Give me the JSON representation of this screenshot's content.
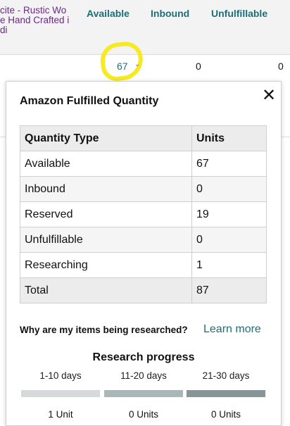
{
  "columns": {
    "available": "Available",
    "inbound": "Inbound",
    "unfulfillable": "Unfulfillable"
  },
  "row": {
    "product_lines": [
      "cite - Rustic Wo",
      "e Hand Crafted i",
      "di"
    ],
    "available": "67",
    "inbound": "0",
    "unfulfillable": "0"
  },
  "popover": {
    "title": "Amazon Fulfilled Quantity",
    "close_icon": "close-icon",
    "table": {
      "headers": [
        "Quantity Type",
        "Units"
      ],
      "rows": [
        {
          "type": "Available",
          "units": "67"
        },
        {
          "type": "Inbound",
          "units": "0"
        },
        {
          "type": "Reserved",
          "units": "19"
        },
        {
          "type": "Unfulfillable",
          "units": "0"
        },
        {
          "type": "Researching",
          "units": "1"
        },
        {
          "type": "Total",
          "units": "87"
        }
      ]
    },
    "research_question": "Why are my items being researched?",
    "learn_more": "Learn more",
    "progress": {
      "title": "Research progress",
      "stages": [
        {
          "label": "1-10 days",
          "count": "1 Unit",
          "color": "#d5d9d9"
        },
        {
          "label": "11-20 days",
          "count": "0 Units",
          "color": "#aab7b8"
        },
        {
          "label": "21-30 days",
          "count": "0 Units",
          "color": "#879596"
        }
      ]
    }
  },
  "colors": {
    "accent": "#1b6f78",
    "product_link": "#6b2a82",
    "highlight": "#f6ea22"
  }
}
